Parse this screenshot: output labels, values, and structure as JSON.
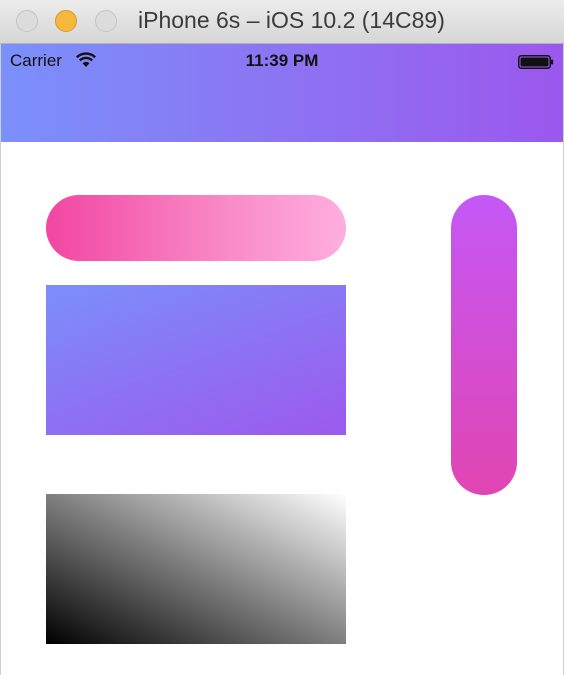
{
  "window": {
    "title": "iPhone 6s – iOS 10.2 (14C89)"
  },
  "status_bar": {
    "carrier": "Carrier",
    "time": "11:39 PM",
    "icons": [
      "wifi-icon",
      "battery-icon"
    ]
  },
  "colors": {
    "navbar_gradient": [
      "#7b90fb",
      "#9b58ee"
    ],
    "pink_pill_gradient": [
      "#f246a1",
      "#ffaee0"
    ],
    "blue_purple_rect_gradient": [
      "#7b8ffb",
      "#9d5aee"
    ],
    "grayscale_rect_gradient": [
      "#000000",
      "#ffffff"
    ],
    "vertical_pill_gradient": [
      "#c458f6",
      "#e145b2"
    ],
    "traffic_minimize": "#f5b73c"
  }
}
